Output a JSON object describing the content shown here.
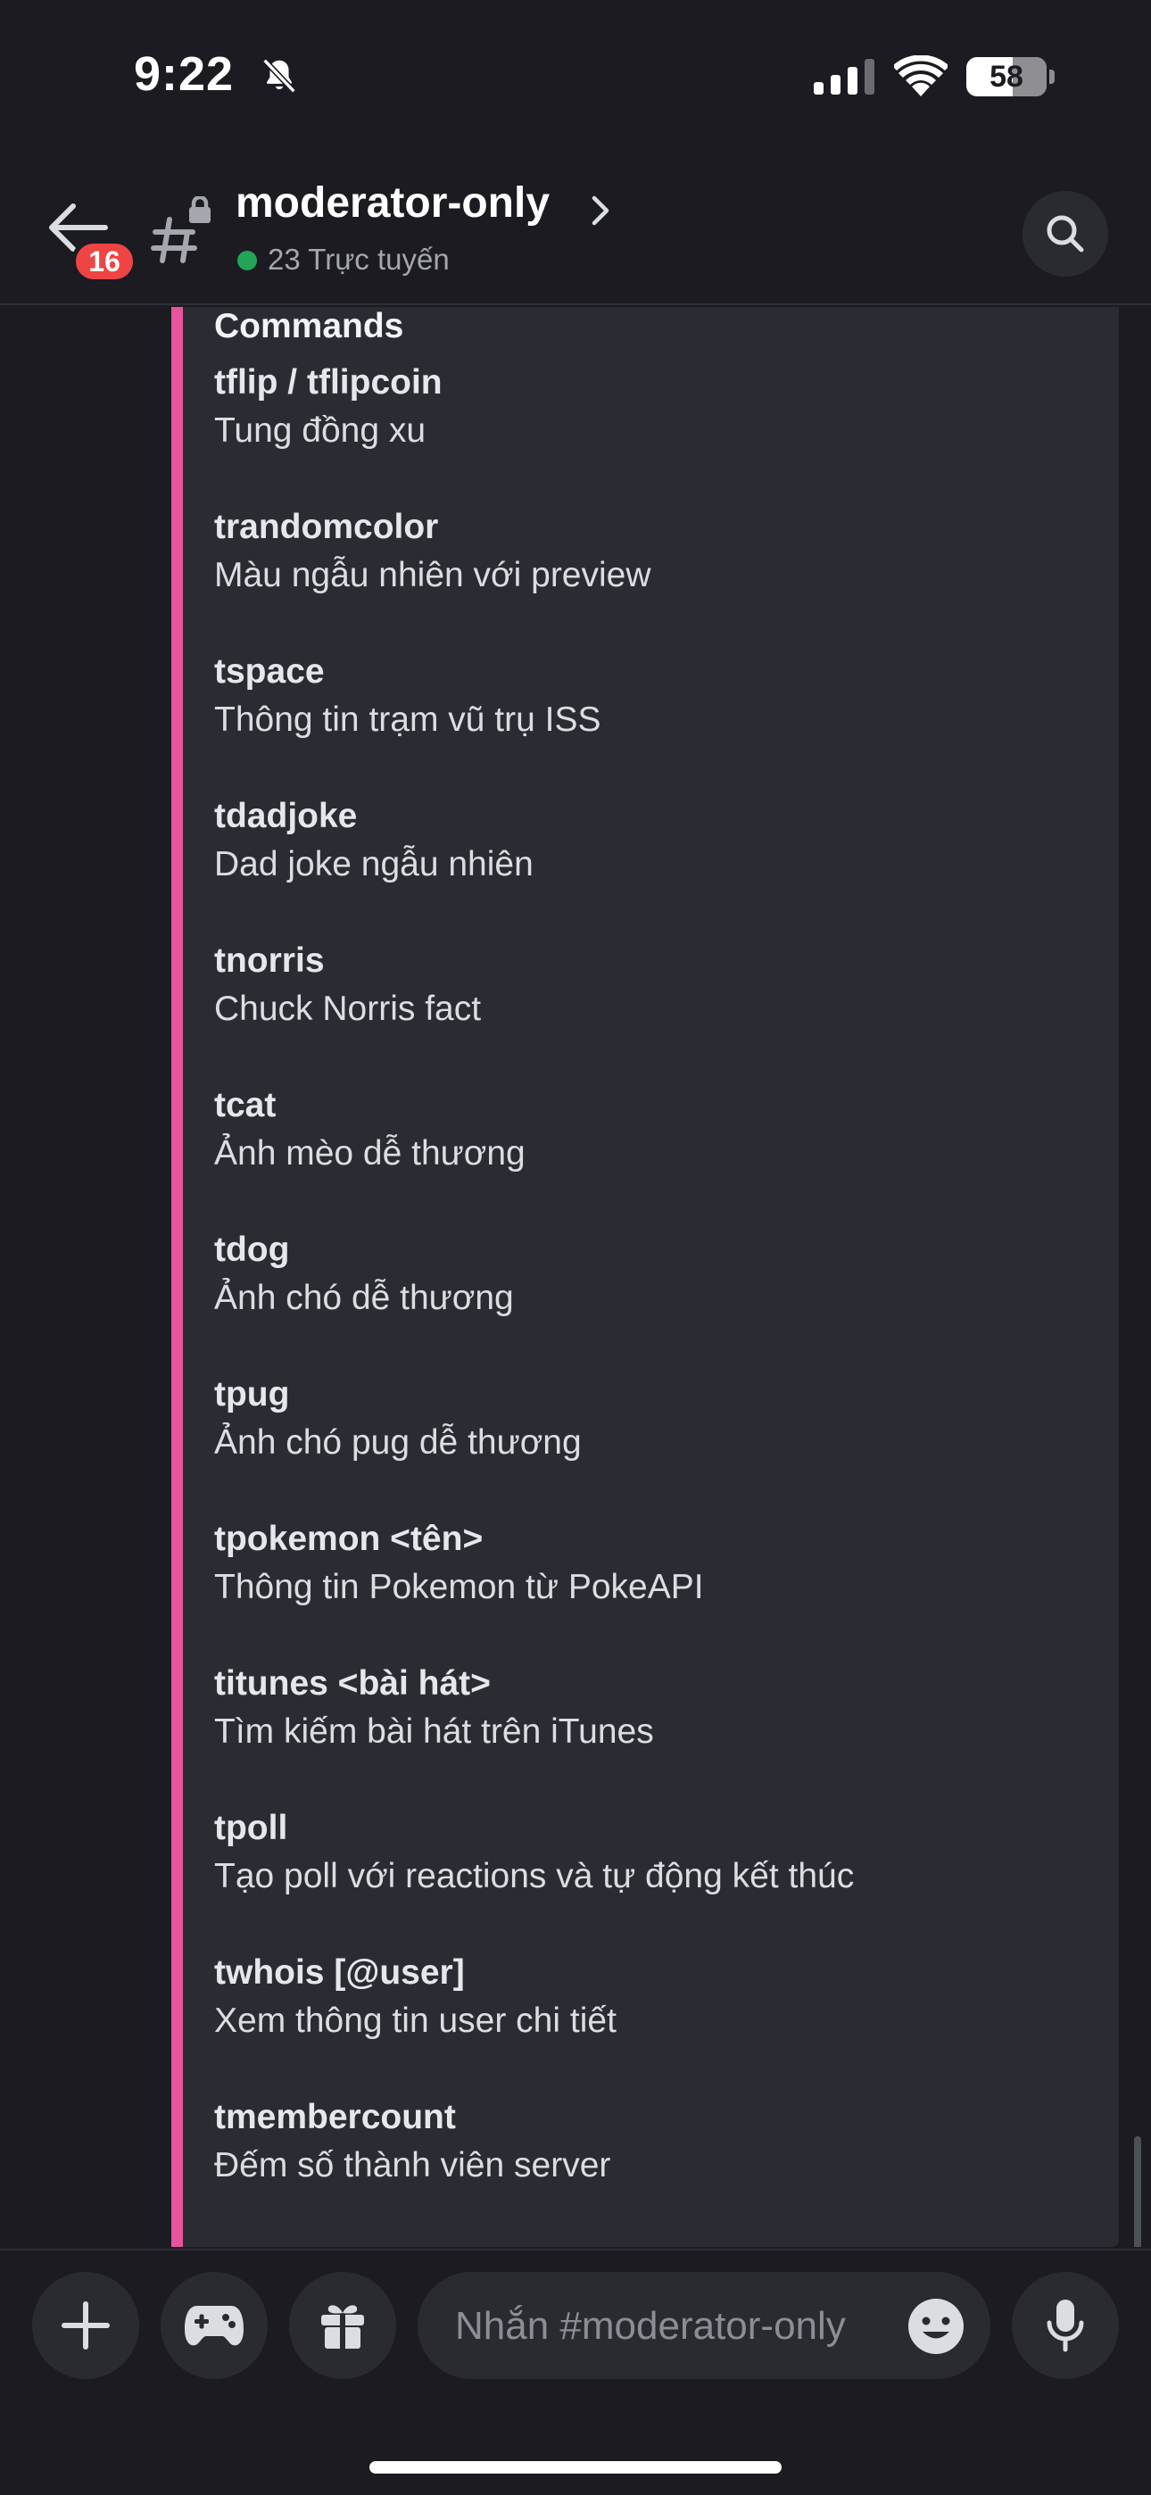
{
  "status_bar": {
    "time": "9:22",
    "battery": "58",
    "battery_level": 0.58,
    "icons": [
      "bell-slash-icon",
      "signal-icon",
      "wifi-icon",
      "battery-icon"
    ]
  },
  "header": {
    "unread_badge": "16",
    "channel_name": "moderator-only",
    "online_status": "23 Trực tuyến",
    "icons": [
      "back-arrow-icon",
      "locked-hash-icon",
      "chevron-right-icon",
      "search-icon"
    ]
  },
  "embed": {
    "section_title": "Commands",
    "accent_color": "#e8549c",
    "commands": [
      {
        "name": "tflip / tflipcoin",
        "desc": "Tung đồng xu"
      },
      {
        "name": "trandomcolor",
        "desc": "Màu ngẫu nhiên với preview"
      },
      {
        "name": "tspace",
        "desc": "Thông tin trạm vũ trụ ISS"
      },
      {
        "name": "tdadjoke",
        "desc": "Dad joke ngẫu nhiên"
      },
      {
        "name": "tnorris",
        "desc": "Chuck Norris fact"
      },
      {
        "name": "tcat",
        "desc": "Ảnh mèo dễ thương"
      },
      {
        "name": "tdog",
        "desc": "Ảnh chó dễ thương"
      },
      {
        "name": "tpug",
        "desc": "Ảnh chó pug dễ thương"
      },
      {
        "name": "tpokemon <tên>",
        "desc": "Thông tin Pokemon từ PokeAPI"
      },
      {
        "name": "titunes <bài hát>",
        "desc": "Tìm kiếm bài hát trên iTunes"
      },
      {
        "name": "tpoll",
        "desc": "Tạo poll với reactions và tự động kết thúc"
      },
      {
        "name": "twhois [@user]",
        "desc": "Xem thông tin user chi tiết"
      },
      {
        "name": "tmembercount",
        "desc": "Đếm số thành viên server"
      }
    ]
  },
  "composer": {
    "placeholder": "Nhắn #moderator-only",
    "icons": [
      "plus-icon",
      "gamepad-icon",
      "gift-icon",
      "emoji-icon",
      "microphone-icon"
    ]
  },
  "colors": {
    "background": "#1b1b21",
    "embed_background": "#2b2c33",
    "badge": "#ef4444",
    "online": "#23a559"
  }
}
